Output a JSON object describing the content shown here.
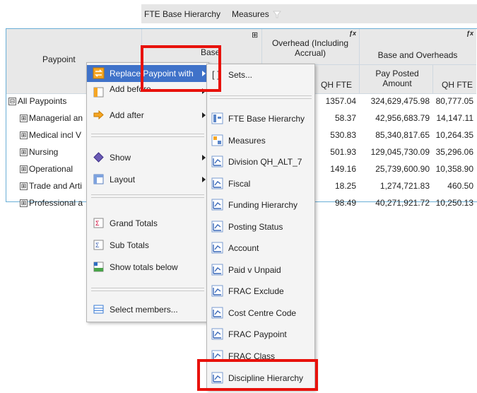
{
  "hierarchy_bar": {
    "label1": "FTE Base Hierarchy",
    "label2": "Measures"
  },
  "grid": {
    "paypoint_header": "Paypoint",
    "base_header": "Base",
    "overhead_header": "Overhead (Including Accrual)",
    "base_overheads_header": "Base and Overheads",
    "qh_fte_1": "QH FTE",
    "pay_posted_amount": "Pay Posted Amount",
    "qh_fte_2": "QH FTE",
    "plus_symbol": "⊞",
    "fx_symbol": "ƒx",
    "rows": [
      {
        "label": "All Paypoints",
        "sign": "⊟",
        "oh_fte": "1357.04",
        "pay": "324,629,475.98",
        "bo_fte": "80,777.05"
      },
      {
        "label": "Managerial an",
        "sign": "⊞",
        "oh_fte": "58.37",
        "pay": "42,956,683.79",
        "bo_fte": "14,147.11"
      },
      {
        "label": "Medical incl V",
        "sign": "⊞",
        "oh_fte": "530.83",
        "pay": "85,340,817.65",
        "bo_fte": "10,264.35"
      },
      {
        "label": "Nursing",
        "sign": "⊞",
        "oh_fte": "501.93",
        "pay": "129,045,730.09",
        "bo_fte": "35,296.06"
      },
      {
        "label": "Operational",
        "sign": "⊞",
        "oh_fte": "149.16",
        "pay": "25,739,600.90",
        "bo_fte": "10,358.90"
      },
      {
        "label": "Trade and Arti",
        "sign": "⊞",
        "oh_fte": "18.25",
        "pay": "1,274,721.83",
        "bo_fte": "460.50"
      },
      {
        "label": "Professional a",
        "sign": "⊞",
        "oh_fte": "98.49",
        "pay": "40,271,921.72",
        "bo_fte": "10,250.13"
      }
    ]
  },
  "context_menu": {
    "replace": "Replace Paypoint with",
    "add_before": "Add before",
    "add_after": "Add after",
    "show": "Show",
    "layout": "Layout",
    "grand_totals": "Grand Totals",
    "sub_totals": "Sub Totals",
    "show_totals_below": "Show totals below",
    "select_members": "Select members..."
  },
  "submenu": {
    "sets": "Sets...",
    "items": [
      "FTE Base Hierarchy",
      "Measures",
      "Division QH_ALT_7",
      "Fiscal",
      "Funding Hierarchy",
      "Posting Status",
      "Account",
      "Paid v Unpaid",
      "FRAC Exclude",
      "Cost Centre Code",
      "FRAC Paypoint",
      "FRAC Class",
      "Discipline Hierarchy"
    ]
  },
  "colors": {
    "highlight_red": "#e8120c",
    "grid_border": "#6aaed6",
    "menu_bg": "#f4f4f4"
  },
  "icons": {
    "hierarchy": "hierarchy-icon",
    "measures": "measures-icon",
    "dimension": "dimension-icon"
  }
}
